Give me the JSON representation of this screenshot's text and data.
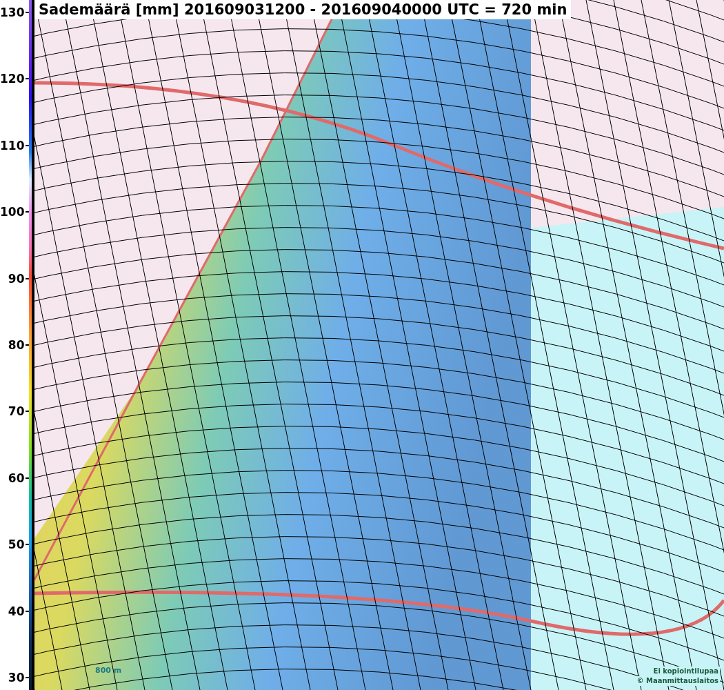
{
  "title": "Sademäärä [mm] 201609031200 - 201609040000 UTC = 720 min",
  "colorbar": {
    "ticks": [
      "130",
      "120",
      "110",
      "100",
      "90",
      "80",
      "70",
      "60",
      "50",
      "40",
      "30"
    ]
  },
  "map": {
    "scale_label": "800 m",
    "attribution": [
      "Ei kopiointilupaa",
      "© Maanmittauslaitos"
    ]
  }
}
